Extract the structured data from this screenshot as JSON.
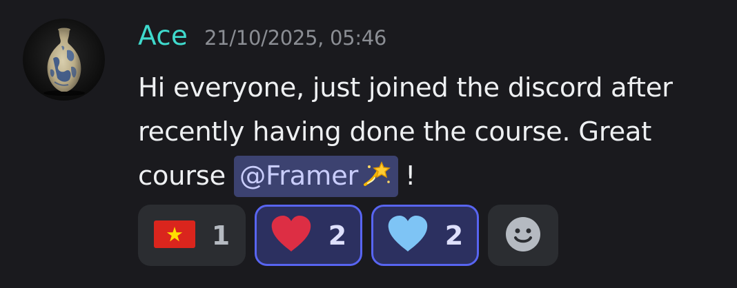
{
  "message": {
    "author": "Ace",
    "timestamp": "21/10/2025, 05:46",
    "text_line1": "Hi everyone, just joined the discord after",
    "text_line2": "recently having done the course. Great",
    "text_line3_prefix": "course ",
    "mention": "@Framer",
    "mention_emoji": "dizzy-emoji",
    "text_line3_suffix": "!",
    "author_color": "#3fd9cc",
    "mention_bg": "#3c4270"
  },
  "reactions": [
    {
      "emoji": "vietnam-flag-emoji",
      "count": "1",
      "active": false
    },
    {
      "emoji": "red-heart-emoji",
      "count": "2",
      "active": true
    },
    {
      "emoji": "light-blue-heart-emoji",
      "count": "2",
      "active": true
    },
    {
      "emoji": "add-reaction-smiley-icon",
      "count": "",
      "active": false
    }
  ],
  "colors": {
    "background": "#1a1a1e",
    "reaction_bg": "#2b2d31",
    "reaction_active_bg": "#2c3060",
    "reaction_active_border": "#5865f2"
  }
}
